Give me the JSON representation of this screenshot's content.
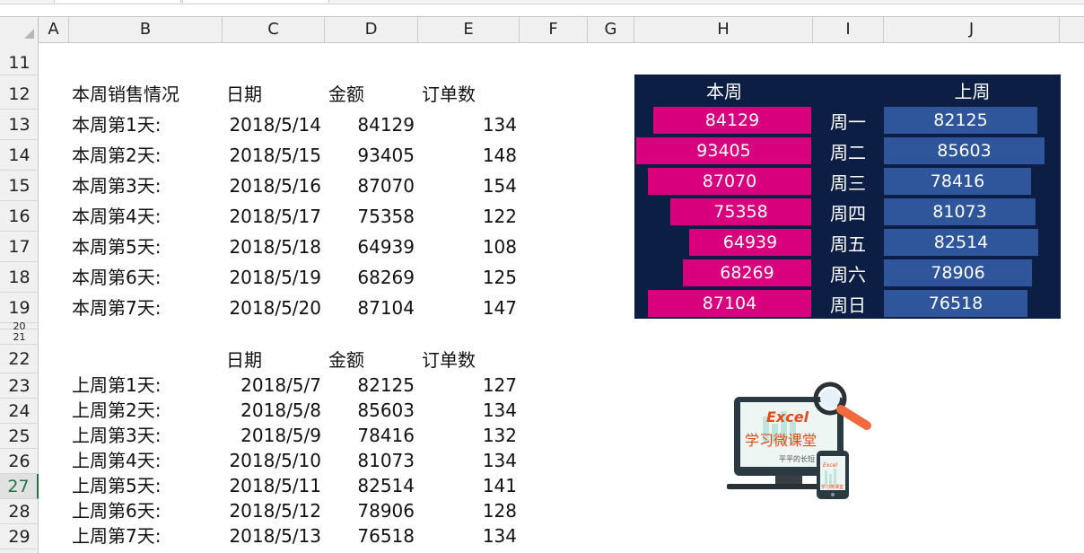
{
  "columns": [
    "A",
    "B",
    "C",
    "D",
    "E",
    "F",
    "G",
    "H",
    "I",
    "J"
  ],
  "rows": [
    "11",
    "12",
    "13",
    "14",
    "15",
    "16",
    "17",
    "18",
    "19",
    "20",
    "21",
    "22",
    "23",
    "24",
    "25",
    "26",
    "27",
    "28",
    "29"
  ],
  "selected_row": "27",
  "this_week": {
    "header": {
      "label": "本周销售情况",
      "date": "日期",
      "amount": "金额",
      "orders": "订单数"
    },
    "rows": [
      {
        "label": "本周第1天:",
        "date": "2018/5/14",
        "amount": "84129",
        "orders": "134"
      },
      {
        "label": "本周第2天:",
        "date": "2018/5/15",
        "amount": "93405",
        "orders": "148"
      },
      {
        "label": "本周第3天:",
        "date": "2018/5/16",
        "amount": "87070",
        "orders": "154"
      },
      {
        "label": "本周第4天:",
        "date": "2018/5/17",
        "amount": "75358",
        "orders": "122"
      },
      {
        "label": "本周第5天:",
        "date": "2018/5/18",
        "amount": "64939",
        "orders": "108"
      },
      {
        "label": "本周第6天:",
        "date": "2018/5/19",
        "amount": "68269",
        "orders": "125"
      },
      {
        "label": "本周第7天:",
        "date": "2018/5/20",
        "amount": "87104",
        "orders": "147"
      }
    ]
  },
  "last_week": {
    "header": {
      "date": "日期",
      "amount": "金额",
      "orders": "订单数"
    },
    "rows": [
      {
        "label": "上周第1天:",
        "date": "2018/5/7",
        "amount": "82125",
        "orders": "127"
      },
      {
        "label": "上周第2天:",
        "date": "2018/5/8",
        "amount": "85603",
        "orders": "134"
      },
      {
        "label": "上周第3天:",
        "date": "2018/5/9",
        "amount": "78416",
        "orders": "132"
      },
      {
        "label": "上周第4天:",
        "date": "2018/5/10",
        "amount": "81073",
        "orders": "134"
      },
      {
        "label": "上周第5天:",
        "date": "2018/5/11",
        "amount": "82514",
        "orders": "141"
      },
      {
        "label": "上周第6天:",
        "date": "2018/5/12",
        "amount": "78906",
        "orders": "128"
      },
      {
        "label": "上周第7天:",
        "date": "2018/5/13",
        "amount": "76518",
        "orders": "134"
      }
    ]
  },
  "panel": {
    "left_title": "本周",
    "right_title": "上周",
    "days": [
      "周一",
      "周二",
      "周三",
      "周四",
      "周五",
      "周六",
      "周日"
    ],
    "scale_max": 93405,
    "this_week_values": [
      84129,
      93405,
      87070,
      75358,
      64939,
      68269,
      87104
    ],
    "last_week_values": [
      82125,
      85603,
      78416,
      81073,
      82514,
      78906,
      76518
    ],
    "colors": {
      "background": "#0c1e44",
      "this_week_bar": "#d9007e",
      "last_week_bar": "#2f569a"
    }
  },
  "logo": {
    "word": "Excel",
    "name": "学习微课堂",
    "tagline": "平平的长短",
    "phone_word": "Excel",
    "phone_name": "学习微课堂"
  }
}
